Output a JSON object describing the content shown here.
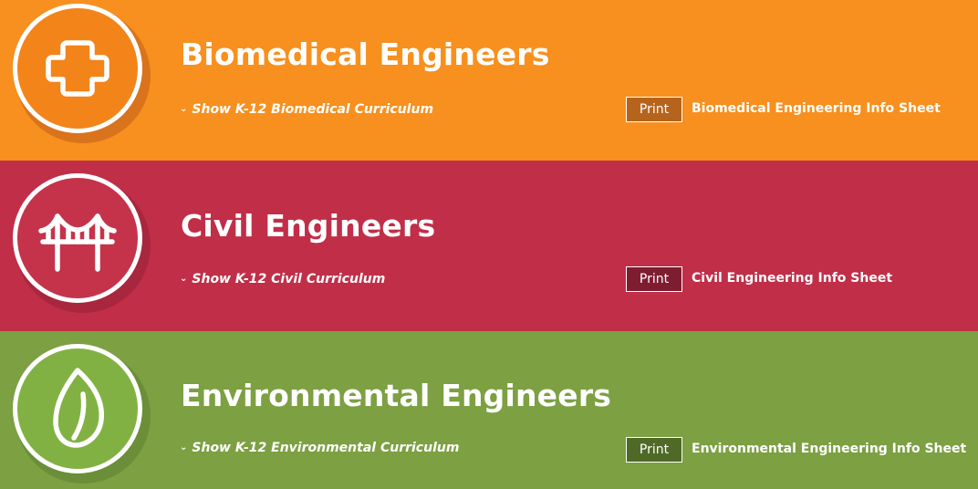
{
  "sections": [
    {
      "title": "Biomedical Engineers",
      "curriculum_toggle": "Show K-12 Biomedical Curriculum",
      "chevron": "⌄",
      "print_label": "Print",
      "info_sheet": "Biomedical Engineering Info Sheet",
      "icon": "medical-cross-icon",
      "colors": {
        "background": "#f7901e",
        "circle": "#f3841a",
        "shadow": "#d9731c",
        "print_bg": "#b6641d"
      }
    },
    {
      "title": "Civil Engineers",
      "curriculum_toggle": "Show K-12 Civil Curriculum",
      "chevron": "⌄",
      "print_label": "Print",
      "info_sheet": "Civil Engineering Info Sheet",
      "icon": "bridge-icon",
      "colors": {
        "background": "#c12e48",
        "circle": "#c5334b",
        "shadow": "#a8263e",
        "print_bg": "#7e1d30"
      }
    },
    {
      "title": "Environmental Engineers",
      "curriculum_toggle": "Show K-12 Environmental Curriculum",
      "chevron": "⌄",
      "print_label": "Print",
      "info_sheet": "Environmental Engineering Info Sheet",
      "icon": "leaf-icon",
      "colors": {
        "background": "#7ca042",
        "circle": "#82b143",
        "shadow": "#6b8f38",
        "print_bg": "#4f6a27"
      }
    }
  ]
}
